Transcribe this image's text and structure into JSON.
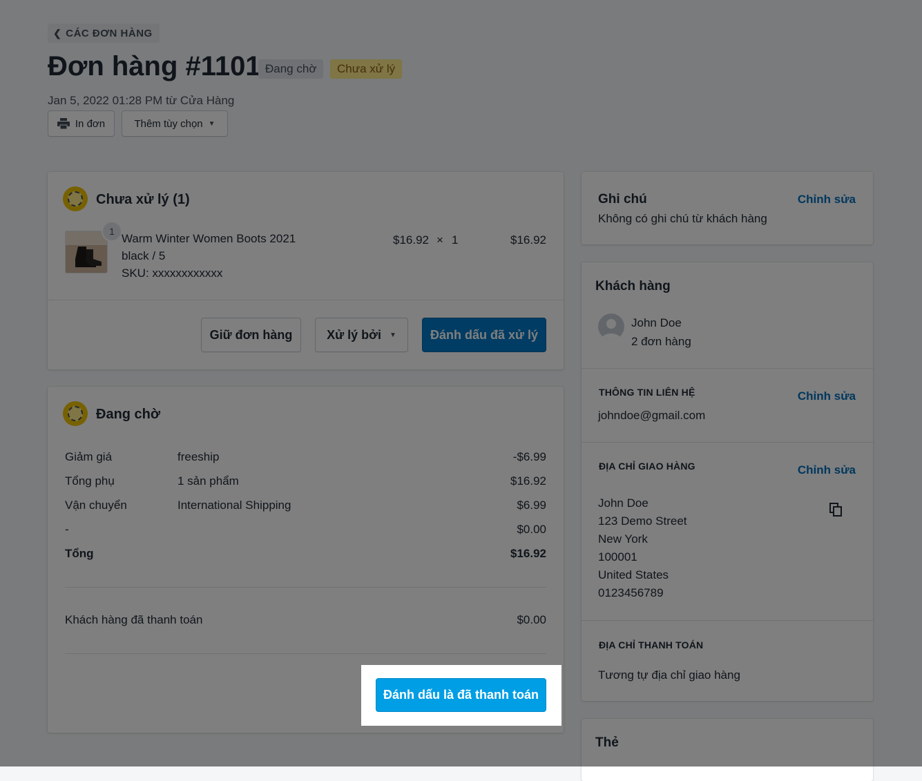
{
  "header": {
    "back_label": "CÁC ĐƠN HÀNG",
    "title": "Đơn hàng #1101",
    "badge_pending": "Đang chờ",
    "badge_unfulfilled": "Chưa xử lý",
    "meta": "Jan 5, 2022 01:28 PM từ Cửa Hàng",
    "print_label": "In đơn",
    "more_label": "Thêm tùy chọn"
  },
  "unfulfilled": {
    "title": "Chưa xử lý (1)",
    "item": {
      "qty_badge": "1",
      "name": "Warm Winter Women Boots 2021",
      "variant": "black / 5",
      "sku": "SKU: xxxxxxxxxxxx",
      "unit_price": "$16.92",
      "times": "×",
      "quantity": "1",
      "total": "$16.92"
    },
    "hold_label": "Giữ đơn hàng",
    "fulfill_by_label": "Xử lý bởi",
    "mark_fulfilled_label": "Đánh dấu đã xử lý"
  },
  "payment": {
    "title": "Đang chờ",
    "rows": [
      {
        "label": "Giảm giá",
        "desc": "freeship",
        "amount": "-$6.99"
      },
      {
        "label": "Tổng phụ",
        "desc": "1 sản phẩm",
        "amount": "$16.92"
      },
      {
        "label": "Vận chuyển",
        "desc": "International Shipping",
        "amount": "$6.99"
      },
      {
        "label": "-",
        "desc": "",
        "amount": "$0.00"
      }
    ],
    "total_label": "Tổng",
    "total_amount": "$16.92",
    "paid_label": "Khách hàng đã thanh toán",
    "paid_amount": "$0.00",
    "mark_paid_label": "Đánh dấu là đã thanh toán"
  },
  "notes": {
    "title": "Ghi chú",
    "edit_label": "Chỉnh sửa",
    "text": "Không có ghi chú từ khách hàng"
  },
  "customer": {
    "title": "Khách hàng",
    "name": "John Doe",
    "orders": "2 đơn hàng",
    "contact_title": "THÔNG TIN LIÊN HỆ",
    "contact_edit": "Chỉnh sửa",
    "email": "johndoe@gmail.com",
    "shipping_title": "ĐỊA CHỈ GIAO HÀNG",
    "shipping_edit": "Chỉnh sửa",
    "shipping_lines": [
      "John Doe",
      "123 Demo Street",
      "New York",
      "100001",
      "United States",
      "0123456789"
    ],
    "billing_title": "ĐỊA CHỈ THANH TOÁN",
    "billing_text": "Tương tự địa chỉ giao hàng"
  },
  "tags": {
    "title": "Thẻ"
  }
}
